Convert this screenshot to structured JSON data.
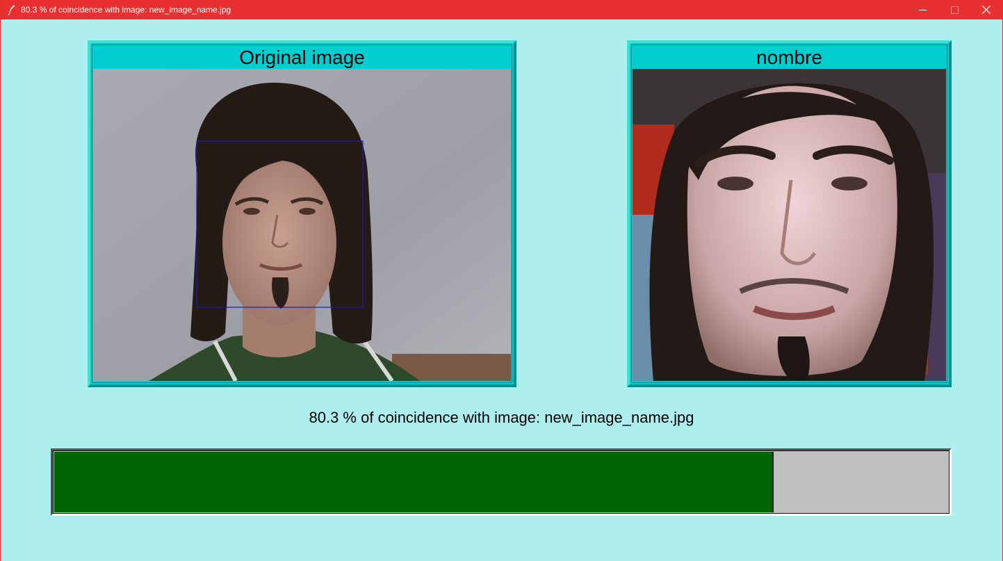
{
  "window": {
    "title": "80.3 % of coincidence with image: new_image_name.jpg",
    "icon": "feather-icon"
  },
  "panels": {
    "original": {
      "title": "Original image"
    },
    "match": {
      "title": "nombre"
    }
  },
  "status": {
    "text": "80.3 % of coincidence with image: new_image_name.jpg"
  },
  "progress": {
    "value_percent": 80.3,
    "fill_color": "#006400",
    "track_color": "#c0c0c0"
  },
  "colors": {
    "titlebar": "#e83030",
    "background": "#afeeee",
    "panel": "#00ced1"
  }
}
